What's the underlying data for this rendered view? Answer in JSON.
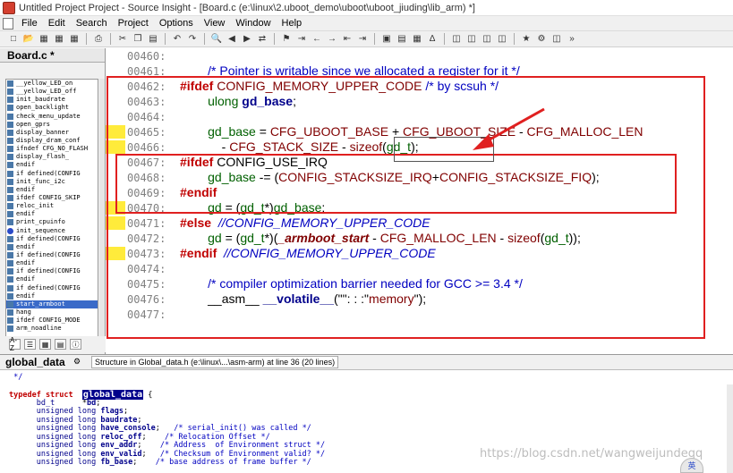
{
  "window": {
    "title": "Untitled Project Project - Source Insight - [Board.c (e:\\linux\\2.uboot_demo\\uboot\\uboot_jiuding\\lib_arm) *]"
  },
  "menu": [
    "File",
    "Edit",
    "Search",
    "Project",
    "Options",
    "View",
    "Window",
    "Help"
  ],
  "toolbar": {
    "icons": [
      "new-file",
      "open-file",
      "save",
      "save-all",
      "close-file",
      "print",
      "cut",
      "copy",
      "paste",
      "undo",
      "redo",
      "find",
      "find-prev",
      "find-next",
      "replace",
      "jump",
      "bookmark",
      "back",
      "forward",
      "go-left",
      "go-right",
      "lookup",
      "browse",
      "relation",
      "symbol",
      "panel-1",
      "panel-2",
      "panel-3",
      "panel-4",
      "context",
      "project",
      "split",
      "more"
    ]
  },
  "symbol_window": {
    "title": "Board.c *",
    "items": [
      "__yellow_LED_on",
      "__yellow_LED_off",
      "init_baudrate",
      "open_backlight",
      "check_menu_update",
      "open_gprs",
      "display_banner",
      "display_dram_conf",
      "ifndef CFG_NO_FLASH",
      "display_flash_",
      "endif",
      "if defined(CONFIG",
      "init_func_i2c",
      "endif",
      "ifdef CONFIG_SKIP",
      "reloc_init",
      "endif",
      "print_cpuinfo",
      "init_sequence",
      "if defined(CONFIG",
      "endif",
      "if defined(CONFIG",
      "endif",
      "if defined(CONFIG",
      "endif",
      "if defined(CONFIG",
      "endif",
      "start_armboot",
      "hang",
      "ifdef CONFIG_MODE",
      "arm_noadline"
    ],
    "selected": "start_armboot",
    "bottom_buttons": [
      "A-Z",
      "list",
      "grid",
      "tree",
      "info"
    ]
  },
  "editor": {
    "lines": [
      {
        "n": "00460:",
        "segs": []
      },
      {
        "n": "00461:",
        "segs": [
          [
            "",
            "        "
          ],
          [
            "cmt",
            "/* Pointer is writable since we allocated a register for it */"
          ]
        ]
      },
      {
        "n": "00462:",
        "segs": [
          [
            "kw",
            "#ifdef "
          ],
          [
            "macro",
            "CONFIG_MEMORY_UPPER_CODE"
          ],
          [
            "",
            " "
          ],
          [
            "cmt",
            "/* by scsuh */"
          ]
        ]
      },
      {
        "n": "00463:",
        "segs": [
          [
            "",
            "        "
          ],
          [
            "ident",
            "ulong "
          ],
          [
            "var",
            "gd_base"
          ],
          [
            "",
            ";"
          ]
        ]
      },
      {
        "n": "00464:",
        "segs": []
      },
      {
        "n": "00465:",
        "segs": [
          [
            "",
            "        "
          ],
          [
            "ident",
            "gd_base"
          ],
          [
            "",
            " = "
          ],
          [
            "macro",
            "CFG_UBOOT_BASE"
          ],
          [
            "",
            " + "
          ],
          [
            "macro",
            "CFG_UBOOT_SIZE"
          ],
          [
            "",
            " - "
          ],
          [
            "macro",
            "CFG_MALLOC_LEN"
          ]
        ]
      },
      {
        "n": "00466:",
        "segs": [
          [
            "",
            "            - "
          ],
          [
            "macro",
            "CFG_STACK_SIZE"
          ],
          [
            "",
            " - "
          ],
          [
            "macro",
            "sizeof"
          ],
          [
            "",
            "("
          ],
          [
            "ident",
            "gd_t"
          ],
          [
            "",
            ");"
          ]
        ]
      },
      {
        "n": "00467:",
        "segs": [
          [
            "kw",
            "#ifdef "
          ],
          [
            "",
            "CONFIG_USE_IRQ"
          ]
        ]
      },
      {
        "n": "00468:",
        "segs": [
          [
            "",
            "        "
          ],
          [
            "ident",
            "gd_base"
          ],
          [
            "",
            " -= ("
          ],
          [
            "macro",
            "CONFIG_STACKSIZE_IRQ"
          ],
          [
            "",
            "+"
          ],
          [
            "macro",
            "CONFIG_STACKSIZE_FIQ"
          ],
          [
            "",
            ");"
          ]
        ]
      },
      {
        "n": "00469:",
        "segs": [
          [
            "kw",
            "#endif"
          ]
        ]
      },
      {
        "n": "00470:",
        "segs": [
          [
            "",
            "        "
          ],
          [
            "ident",
            "gd"
          ],
          [
            "",
            " = ("
          ],
          [
            "ident",
            "gd_t"
          ],
          [
            "",
            "*)"
          ],
          [
            "ident",
            "gd_base"
          ],
          [
            "",
            ";"
          ]
        ]
      },
      {
        "n": "00471:",
        "segs": [
          [
            "kw",
            "#else"
          ],
          [
            "",
            "  "
          ],
          [
            "cmt-it",
            "//CONFIG_MEMORY_UPPER_CODE"
          ]
        ]
      },
      {
        "n": "00472:",
        "segs": [
          [
            "",
            "        "
          ],
          [
            "ident",
            "gd"
          ],
          [
            "",
            " = ("
          ],
          [
            "ident",
            "gd_t"
          ],
          [
            "",
            "*)("
          ],
          [
            "fn",
            "_armboot_start"
          ],
          [
            "",
            " - "
          ],
          [
            "macro",
            "CFG_MALLOC_LEN"
          ],
          [
            "",
            " - "
          ],
          [
            "macro",
            "sizeof"
          ],
          [
            "",
            "("
          ],
          [
            "ident",
            "gd_t"
          ],
          [
            "",
            "));"
          ]
        ]
      },
      {
        "n": "00473:",
        "segs": [
          [
            "kw",
            "#endif"
          ],
          [
            "",
            "  "
          ],
          [
            "cmt-it",
            "//CONFIG_MEMORY_UPPER_CODE"
          ]
        ]
      },
      {
        "n": "00474:",
        "segs": []
      },
      {
        "n": "00475:",
        "segs": [
          [
            "",
            "        "
          ],
          [
            "cmt",
            "/* compiler optimization barrier needed for GCC >= 3.4 */"
          ]
        ]
      },
      {
        "n": "00476:",
        "segs": [
          [
            "",
            "        __asm__ "
          ],
          [
            "var",
            "__volatile__"
          ],
          [
            "",
            "(\"\": : :\""
          ],
          [
            "str",
            "memory"
          ],
          [
            "",
            "\");"
          ]
        ]
      },
      {
        "n": "00477:",
        "segs": []
      }
    ],
    "breakpoint_lines": [
      "00465:",
      "00466:",
      "00470:",
      "00471:",
      "00473:"
    ]
  },
  "context": {
    "symbol": "global_data",
    "status": "Structure in Global_data.h (e:\\linux\\...\\asm-arm) at line 36 (20 lines)",
    "lines": [
      [
        [
          "ctx-cmt",
          " */"
        ]
      ],
      [],
      [
        [
          "ctx-kw",
          "typedef struct "
        ],
        [
          "",
          " "
        ],
        [
          "ctx-hl",
          "global_data"
        ],
        [
          "",
          " {"
        ]
      ],
      [
        [
          "",
          "      "
        ],
        [
          "ctx-type",
          "bd_t"
        ],
        [
          "",
          "      *"
        ],
        [
          "ctx-id",
          "bd"
        ],
        [
          "",
          ";"
        ]
      ],
      [
        [
          "",
          "      "
        ],
        [
          "ctx-type",
          "unsigned long "
        ],
        [
          "ctx-id",
          "flags"
        ],
        [
          "",
          ";"
        ]
      ],
      [
        [
          "",
          "      "
        ],
        [
          "ctx-type",
          "unsigned long "
        ],
        [
          "ctx-id",
          "baudrate"
        ],
        [
          "",
          ";"
        ]
      ],
      [
        [
          "",
          "      "
        ],
        [
          "ctx-type",
          "unsigned long "
        ],
        [
          "ctx-id",
          "have_console"
        ],
        [
          "",
          ";   "
        ],
        [
          "ctx-cmt",
          "/* serial_init() was called */"
        ]
      ],
      [
        [
          "",
          "      "
        ],
        [
          "ctx-type",
          "unsigned long "
        ],
        [
          "ctx-id",
          "reloc_off"
        ],
        [
          "",
          ";    "
        ],
        [
          "ctx-cmt",
          "/* Relocation Offset */"
        ]
      ],
      [
        [
          "",
          "      "
        ],
        [
          "ctx-type",
          "unsigned long "
        ],
        [
          "ctx-id",
          "env_addr"
        ],
        [
          "",
          ";    "
        ],
        [
          "ctx-cmt",
          "/* Address  of Environment struct */"
        ]
      ],
      [
        [
          "",
          "      "
        ],
        [
          "ctx-type",
          "unsigned long "
        ],
        [
          "ctx-id",
          "env_valid"
        ],
        [
          "",
          ";   "
        ],
        [
          "ctx-cmt",
          "/* Checksum of Environment valid? */"
        ]
      ],
      [
        [
          "",
          "      "
        ],
        [
          "ctx-type",
          "unsigned long "
        ],
        [
          "ctx-id",
          "fb_base"
        ],
        [
          "",
          ";    "
        ],
        [
          "ctx-cmt",
          "/* base address of frame buffer */"
        ]
      ]
    ]
  },
  "watermark": "https://blog.csdn.net/wangweijundeqq",
  "ime_label": "英",
  "colors": {
    "annotation": "#e02020",
    "breakpoint": "#ffeb3b",
    "selected": "#3a6ac8"
  }
}
